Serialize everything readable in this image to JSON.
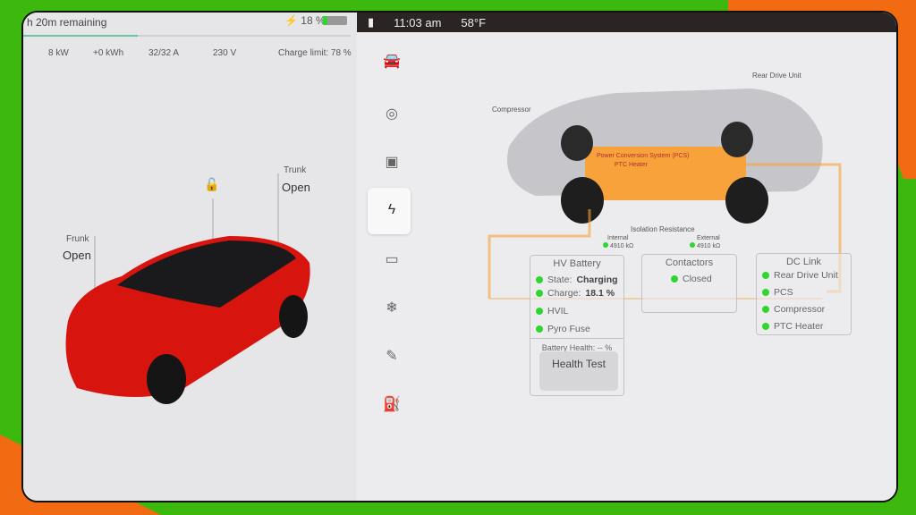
{
  "charging": {
    "remaining": "h 20m remaining",
    "battery_percent": "18 %",
    "progress_fraction": 0.18,
    "stats": [
      "8 kW",
      "+0 kWh",
      "32/32 A",
      "230 V"
    ],
    "charge_limit": "Charge limit: 78 %"
  },
  "car": {
    "frunk_label": "Frunk",
    "frunk_state": "Open",
    "trunk_label": "Trunk",
    "trunk_state": "Open",
    "color": "#d8140f"
  },
  "status_bar": {
    "time": "11:03 am",
    "temperature": "58°F"
  },
  "sidebar": {
    "items": [
      "car-icon",
      "steering-wheel-icon",
      "chip-icon",
      "bolt-icon",
      "battery-icon",
      "snowflake-icon",
      "wrench-icon",
      "fuel-door-icon"
    ],
    "selected": 3
  },
  "diagram": {
    "compressor": "Compressor",
    "rear_drive_unit": "Rear Drive Unit",
    "pcs": "Power Conversion System (PCS)",
    "ptc": "PTC Heater",
    "isolation": "Isolation Resistance",
    "internal_label": "Internal",
    "internal_value": "4910 kΩ",
    "external_label": "External",
    "external_value": "4910 kΩ"
  },
  "hv_battery": {
    "title": "HV Battery",
    "state_label": "State:",
    "state": "Charging",
    "charge_label": "Charge:",
    "charge": "18.1 %",
    "hvil": "HVIL",
    "pyro": "Pyro Fuse",
    "health": "Battery Health: -- %",
    "health_test": "Health Test"
  },
  "contactors": {
    "title": "Contactors",
    "state": "Closed"
  },
  "dc_link": {
    "title": "DC Link",
    "items": [
      "Rear Drive Unit",
      "PCS",
      "Compressor",
      "PTC Heater"
    ]
  },
  "colors": {
    "accent_orange": "#f7a23a",
    "status_green": "#2fd62f"
  }
}
